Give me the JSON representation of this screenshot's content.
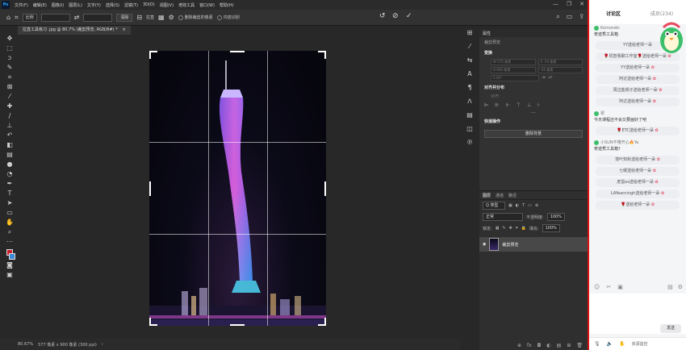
{
  "menubar": {
    "logo": "Ps",
    "items": [
      "文件(F)",
      "编辑(E)",
      "图像(I)",
      "图层(L)",
      "文字(Y)",
      "选择(S)",
      "滤镜(T)",
      "3D(D)",
      "视图(V)",
      "增效工具",
      "窗口(W)",
      "帮助(H)"
    ],
    "window_controls": [
      "—",
      "❐",
      "✕"
    ]
  },
  "options": {
    "ratio_label": "比例",
    "clear_label": "清除",
    "straighten_label": "拉直",
    "delete_pixels_label": "删除裁剪的像素",
    "content_aware_label": "内容识别"
  },
  "document": {
    "tab_title": "拉直工具练习 .jpg @ 80.7% (裁剪预览, RGB/8#) *",
    "tab_close": "×"
  },
  "status": {
    "zoom": "80.67%",
    "dims": "577 像素 x 900 像素 (300 ppi)",
    "arrow": "›"
  },
  "properties": {
    "tab": "属性",
    "crop_preview": "裁剪预览",
    "transform_label": "变换",
    "w_label": "W",
    "w_value": "575 像素",
    "x_label": "X",
    "x_value": "-54 像素",
    "h_label": "H",
    "h_value": "900 像素",
    "y_value": "-65 像素",
    "angle_value": "0.00°",
    "align_label": "对齐并分布",
    "align_to": "对齐:",
    "more": "···",
    "quick_actions": "快速操作",
    "remove_bg": "删除背景"
  },
  "layers": {
    "tabs": [
      "图层",
      "通道",
      "路径"
    ],
    "filter": "Q 类型",
    "blend": "正常",
    "opacity_label": "不透明度:",
    "opacity_value": "100%",
    "lock_label": "锁定:",
    "fill_label": "填充:",
    "fill_value": "100%",
    "layer_name": "裁剪预览",
    "footer_icons": [
      "⊕",
      "fx",
      "◘",
      "◐",
      "▤",
      "⊞",
      "🗑"
    ]
  },
  "chat": {
    "tabs": [
      "讨论区",
      "成员(234)"
    ],
    "messages": [
      {
        "user": "Komorebi",
        "text": "奇迹秀工具箱"
      },
      {
        "user": "翠",
        "text": "今天课程还不会又要画好了吧"
      },
      {
        "user": "小SUN不懂开心🔥Ya",
        "text": "奇迹秀工具箱?"
      }
    ],
    "pills_1": [
      "YY送给老师一朵",
      "🌹机智我聊工作室🌹送给老师一朵",
      "YY送给老师一朵",
      "阿达送给老师一朵",
      "周边盐锅子送给老师一朵",
      "阿达送给老师一朵"
    ],
    "pills_2": [
      "🌹ETC送给老师一朵"
    ],
    "pills_3": [
      "落叶知秋送给老师一朵",
      "七曜送给老师一朵",
      "皮蛋es送给老师一朵",
      "LAYearningh送给老师一朵",
      "🌹送给老师一朵"
    ],
    "send": "发送",
    "bottom_label": "资源监控"
  }
}
